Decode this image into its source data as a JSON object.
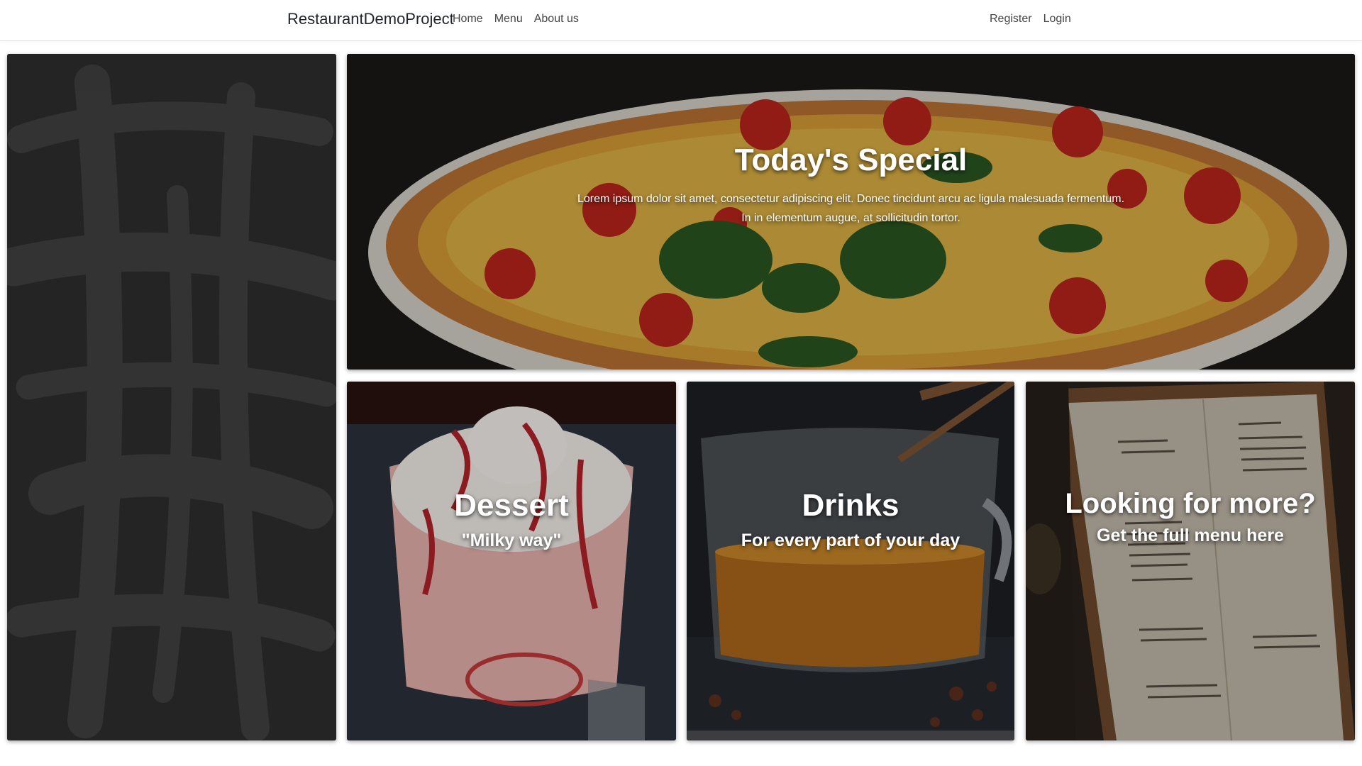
{
  "navbar": {
    "brand": "RestaurantDemoProject",
    "left_links": [
      "Home",
      "Menu",
      "About us"
    ],
    "right_links": [
      "Register",
      "Login"
    ]
  },
  "special": {
    "title": "Today's Special",
    "text_line1": "Lorem ipsum dolor sit amet, consectetur adipiscing elit. Donec tincidunt arcu ac ligula malesuada fermentum.",
    "text_line2": "In in elementum augue, at sollicitudin tortor."
  },
  "dessert": {
    "title": "Dessert",
    "subtitle": "\"Milky way\""
  },
  "drinks": {
    "title": "Drinks",
    "subtitle": "For every part of your day"
  },
  "menu_card": {
    "title": "Looking for more?",
    "subtitle": "Get the full menu here"
  },
  "colors": {
    "navbar_bg": "#ffffff",
    "nav_text": "#444444",
    "caption_text": "#ffffff",
    "chalkboard": "#2a2a2a"
  },
  "icons": {
    "chalkboard": "chalkboard-image",
    "special": "pizza-image",
    "dessert": "milkshake-image",
    "drinks": "tea-cup-image",
    "menu": "menu-board-image"
  }
}
